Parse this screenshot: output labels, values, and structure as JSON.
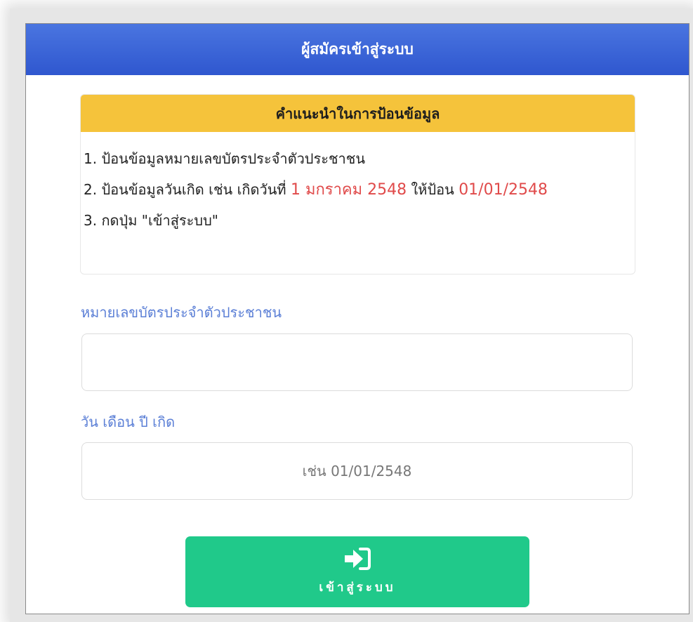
{
  "header": {
    "title": "ผู้สมัครเข้าสู่ระบบ"
  },
  "instructions": {
    "title": "คำแนะนำในการป้อนข้อมูล",
    "step1": "1. ป้อนข้อมูลหมายเลขบัตรประจำตัวประชาชน",
    "step2_prefix": "2. ป้อนข้อมูลวันเกิด เช่น เกิดวันที่ ",
    "step2_date": "1 มกราคม 2548",
    "step2_middle": " ให้ป้อน ",
    "step2_format": "01/01/2548",
    "step3": "3. กดปุ่ม \"เข้าสู่ระบบ\""
  },
  "form": {
    "id_label": "หมายเลขบัตรประจำตัวประชาชน",
    "id_value": "",
    "birthdate_label": "วัน เดือน ปี เกิด",
    "birthdate_placeholder": "เช่น 01/01/2548",
    "birthdate_value": ""
  },
  "submit": {
    "label": "เข้าสู่ระบบ",
    "icon": "sign-in-icon"
  },
  "colors": {
    "header": "#3a63d8",
    "instructions_header": "#f5c33b",
    "highlight": "#e04a4a",
    "label": "#5b7fd6",
    "button": "#20c98a"
  }
}
